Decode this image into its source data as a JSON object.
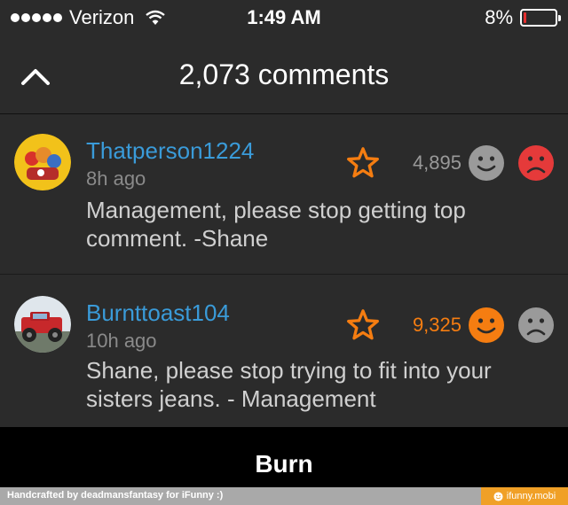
{
  "status_bar": {
    "carrier": "Verizon",
    "time": "1:49 AM",
    "battery_text": "8%",
    "battery_level": 0.08
  },
  "nav": {
    "title": "2,073 comments",
    "back_icon": "chevron-up-icon"
  },
  "comments": [
    {
      "username": "Thatperson1224",
      "time_ago": "8h ago",
      "text": "Management, please stop getting top comment. -Shane",
      "count": "4,895",
      "smile_color": "#9a9a9a",
      "frown_color": "#e53a3a"
    },
    {
      "username": "Burnttoast104",
      "time_ago": "10h ago",
      "text": "Shane, please stop trying to fit into your sisters jeans. - Management",
      "count": "9,325",
      "smile_color": "#f57d11",
      "frown_color": "#9a9a9a"
    }
  ],
  "burn_button": {
    "label": "Burn"
  },
  "footer": {
    "credit": "Handcrafted by deadmansfantasy for iFunny :)",
    "brand": "ifunny.mobi"
  },
  "colors": {
    "accent_orange": "#f57d11",
    "username_blue": "#3a9bd9",
    "panel": "#2b2b2b"
  }
}
